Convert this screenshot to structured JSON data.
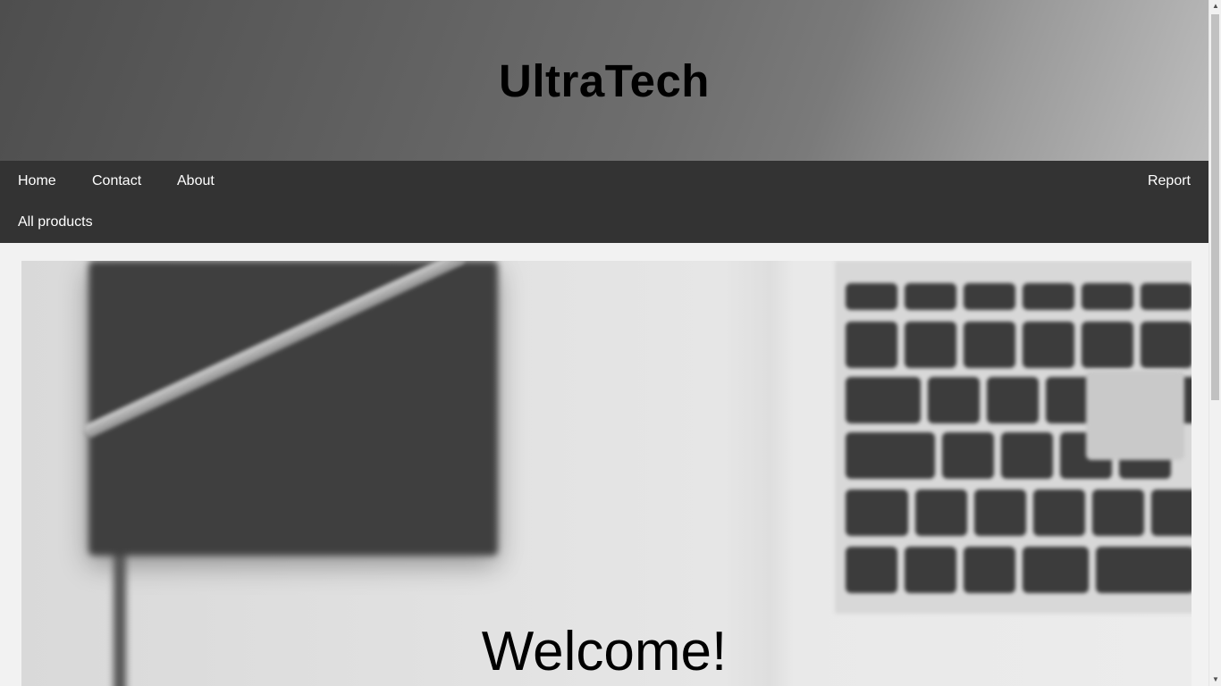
{
  "header": {
    "title": "UltraTech"
  },
  "nav": {
    "items": [
      {
        "label": "Home"
      },
      {
        "label": "Contact"
      },
      {
        "label": "About"
      },
      {
        "label": "All products"
      },
      {
        "label": "Report"
      }
    ]
  },
  "hero": {
    "heading": "Welcome!"
  },
  "colors": {
    "nav_background": "#333333",
    "page_background": "#f2f2f2"
  }
}
